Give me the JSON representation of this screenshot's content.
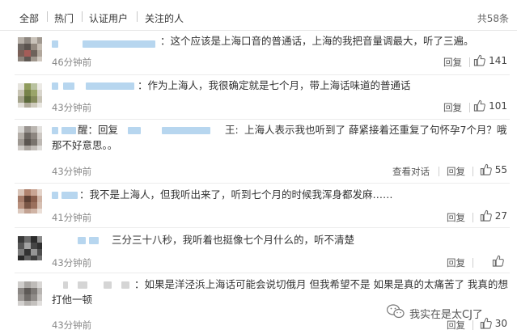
{
  "tabs": [
    "全部",
    "热门",
    "认证用户",
    "关注的人"
  ],
  "total": "共58条",
  "comments": [
    {
      "text": "：这个应该是上海口音的普通话，上海的我把音量调最大，听了三遍。",
      "time": "46分钟前",
      "reply": "回复",
      "likes": "141"
    },
    {
      "text": "：作为上海人，我很确定就是七个月，带上海话味道的普通话",
      "time": "43分钟前",
      "reply": "回复",
      "likes": "101"
    },
    {
      "prefix_a": "醒：回复",
      "prefix_b": "王:",
      "text": "上海人表示我也听到了 薛紧接着还重复了句怀孕7个月？哦那不好意思。。",
      "time": "43分钟前",
      "view": "查看对话",
      "reply": "回复",
      "likes": "55"
    },
    {
      "text": "：我不是上海人，但我听出来了，听到七个月的时候我浑身都发麻……",
      "time": "41分钟前",
      "reply": "回复",
      "likes": "27"
    },
    {
      "text": "三分三十八秒，我听着也挺像七个月什么的，听不清楚",
      "time": "43分钟前",
      "reply": "回复",
      "likes": ""
    },
    {
      "text": "：如果是洋泾浜上海话可能会说切俄月 但我希望不是 如果是真的太痛苦了 我真的想打他一顿",
      "time": "43分钟前",
      "reply": "回复",
      "likes": "30"
    }
  ],
  "watermark": "我实在是太CJ了",
  "colors": {
    "blur": "#b7d6ef",
    "blur2": "#d5d5d5",
    "text": "#333333",
    "muted": "#888888"
  }
}
